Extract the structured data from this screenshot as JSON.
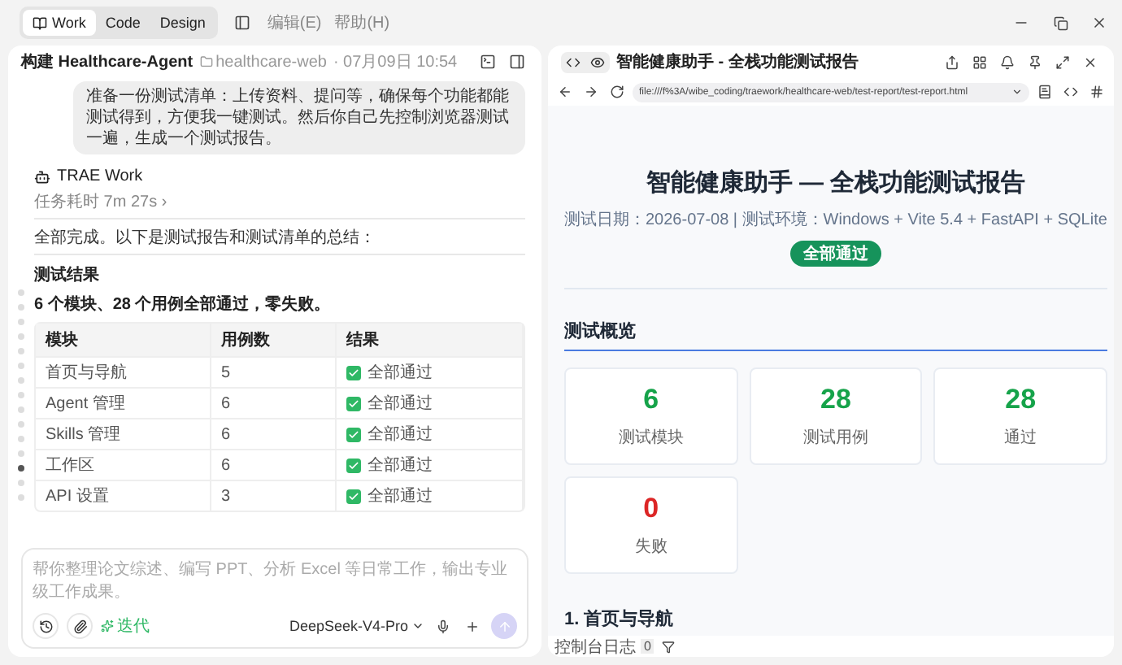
{
  "menu_bar": {
    "mode_tabs": [
      {
        "label": "Work",
        "selected": true
      },
      {
        "label": "Code",
        "selected": false
      },
      {
        "label": "Design",
        "selected": false
      }
    ],
    "menus": [
      "编辑(E)",
      "帮助(H)"
    ]
  },
  "chat": {
    "title": "构建 Healthcare-Agent",
    "project": "healthcare-web",
    "date": "· 07月09日 10:54",
    "user_message": "准备一份测试清单：上传资料、提问等，确保每个功能都能测试得到，方便我一键测试。然后你自己先控制浏览器测试一遍，生成一个测试报告。",
    "agent_name": "TRAE Work",
    "duration": "任务耗时 7m 27s ›",
    "intro": "全部完成。以下是测试报告和测试清单的总结：",
    "section_title": "测试结果",
    "summary": "6 个模块、28 个用例全部通过，零失败。",
    "table": {
      "columns": [
        "模块",
        "用例数",
        "结果"
      ],
      "rows": [
        {
          "module": "首页与导航",
          "cases": "5",
          "result": "全部通过",
          "passed": true
        },
        {
          "module": "Agent 管理",
          "cases": "6",
          "result": "全部通过",
          "passed": true
        },
        {
          "module": "Skills 管理",
          "cases": "6",
          "result": "全部通过",
          "passed": true
        },
        {
          "module": "工作区",
          "cases": "6",
          "result": "全部通过",
          "passed": true
        },
        {
          "module": "API 设置",
          "cases": "3",
          "result": "全部通过",
          "passed": true
        }
      ]
    },
    "nav_dots": [
      {
        "selected": false
      },
      {
        "selected": false
      },
      {
        "selected": false
      },
      {
        "selected": false
      },
      {
        "selected": false
      },
      {
        "selected": false
      },
      {
        "selected": false
      },
      {
        "selected": false
      },
      {
        "selected": false
      },
      {
        "selected": false
      },
      {
        "selected": false
      },
      {
        "selected": false
      },
      {
        "selected": true
      },
      {
        "selected": false
      },
      {
        "selected": false
      }
    ],
    "composer": {
      "placeholder": "帮你整理论文综述、编写 PPT、分析 Excel 等日常工作，输出专业级工作成果。",
      "mode": "迭代",
      "model": "DeepSeek-V4-Pro"
    }
  },
  "preview": {
    "title": "智能健康助手 - 全栈功能测试报告",
    "url": "file:///f%3A/wibe_coding/traework/healthcare-web/test-report/test-report.html",
    "report": {
      "title": "智能健康助手 — 全栈功能测试报告",
      "meta": "测试日期：2026-07-08 | 测试环境：Windows + Vite 5.4 + FastAPI + SQLite",
      "badge": "全部通过",
      "overview_title": "测试概览",
      "stats": [
        {
          "value": "6",
          "label": "测试模块",
          "color": "#16a34a"
        },
        {
          "value": "28",
          "label": "测试用例",
          "color": "#16a34a"
        },
        {
          "value": "28",
          "label": "通过",
          "color": "#16a34a"
        },
        {
          "value": "0",
          "label": "失败",
          "color": "#dc2626"
        }
      ],
      "next_section": "1. 首页与导航"
    },
    "console": {
      "label": "控制台日志",
      "count": "0"
    }
  }
}
